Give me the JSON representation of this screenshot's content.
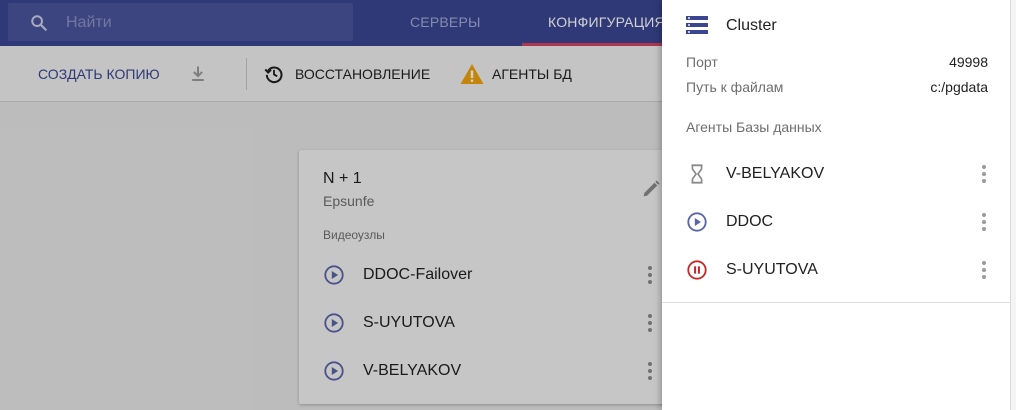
{
  "header": {
    "search_placeholder": "Найти",
    "tabs": [
      {
        "label": "СЕРВЕРЫ",
        "active": false
      },
      {
        "label": "КОНФИГУРАЦИЯ",
        "active": true
      }
    ]
  },
  "toolbar": {
    "copy_label": "СОЗДАТЬ КОПИЮ",
    "restore_label": "ВОССТАНОВЛЕНИЕ",
    "agents_label": "АГЕНТЫ БД"
  },
  "card": {
    "title": "N + 1",
    "subtitle": "Epsunfe",
    "section_label": "Видеоузлы",
    "nodes": [
      {
        "label": "DDOC-Failover",
        "icon": "play-circle-icon"
      },
      {
        "label": "S-UYUTOVA",
        "icon": "play-circle-icon"
      },
      {
        "label": "V-BELYAKOV",
        "icon": "play-circle-icon"
      }
    ]
  },
  "panel": {
    "title": "Cluster",
    "icon": "server-icon",
    "properties": [
      {
        "label": "Порт",
        "value": "49998"
      },
      {
        "label": "Путь к файлам",
        "value": "c:/pgdata"
      }
    ],
    "section_label": "Агенты Базы данных",
    "agents": [
      {
        "label": "V-BELYAKOV",
        "status": "hourglass-icon"
      },
      {
        "label": "DDOC",
        "status": "play-circle-icon"
      },
      {
        "label": "S-UYUTOVA",
        "status": "pause-circle-icon"
      }
    ]
  },
  "colors": {
    "header_bg": "#3a4692",
    "tab_indicator": "#d6435e",
    "accent": "#3a4692",
    "play_icon": "#5a64a8",
    "pause_icon": "#c62828",
    "warning": "#f0a30a"
  }
}
